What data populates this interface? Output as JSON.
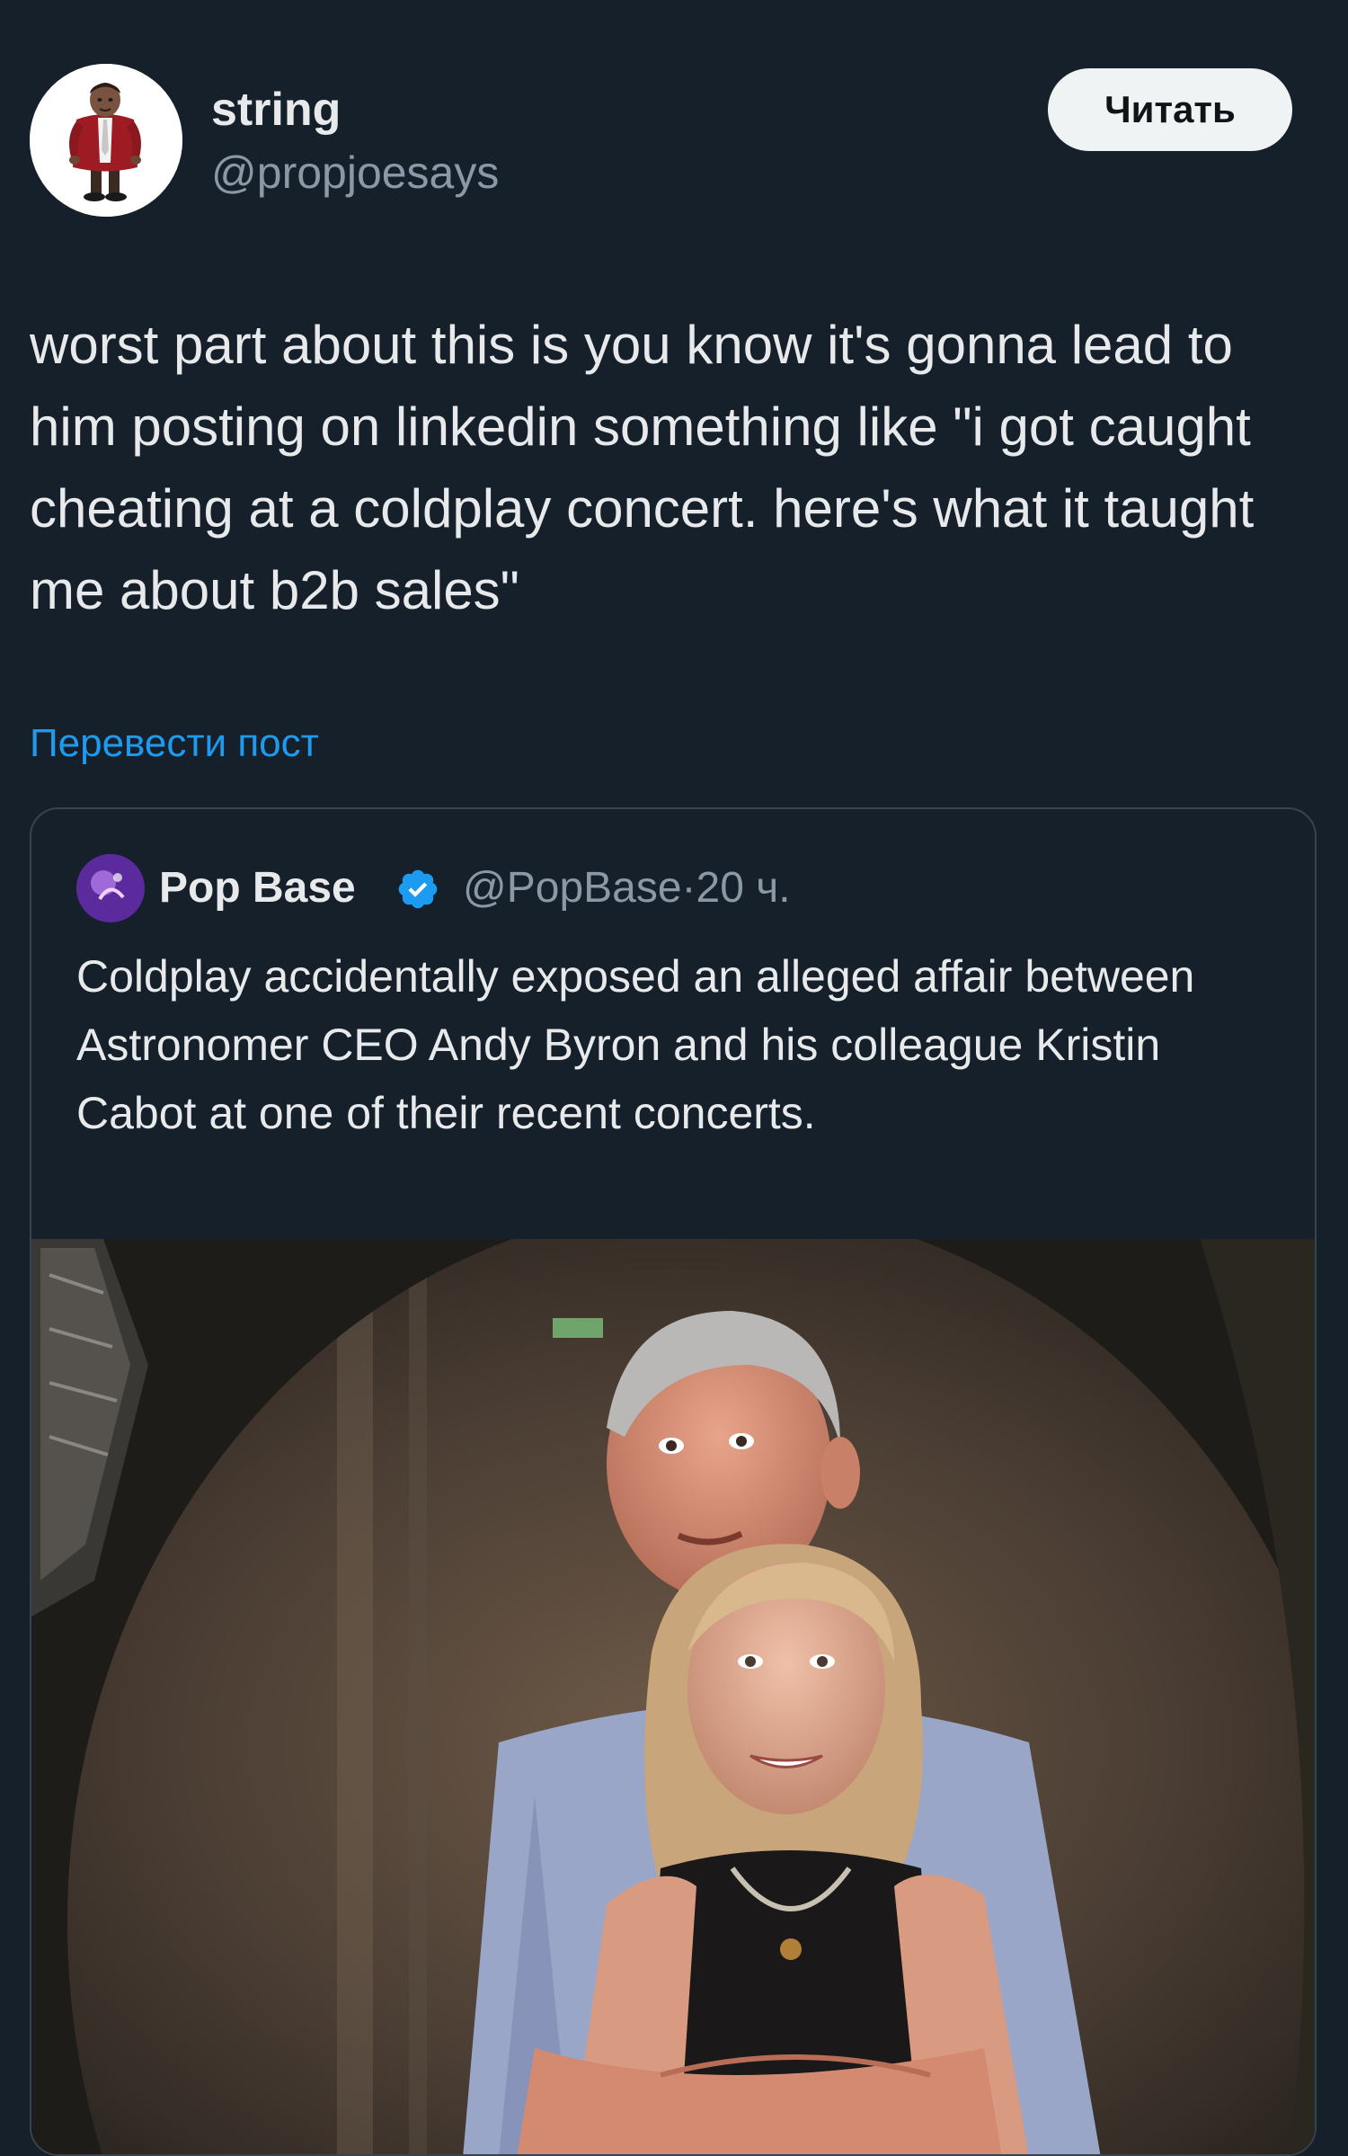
{
  "author": {
    "display_name": "string",
    "handle": "@propjoesays",
    "follow_label": "Читать"
  },
  "tweet": {
    "text": "worst part about this is you know it's gonna lead to him posting on linkedin something like \"i got caught cheating at a coldplay concert. here's what it taught me about b2b sales\"",
    "translate_label": "Перевести пост"
  },
  "quote": {
    "display_name": "Pop Base",
    "handle": "@PopBase",
    "separator": "·",
    "time": "20 ч.",
    "text": "Coldplay accidentally exposed an alleged affair between Astronomer CEO Andy Byron and his colleague Kristin Cabot at one of their recent concerts.",
    "verified": true
  },
  "colors": {
    "background": "#15202b",
    "accent": "#1d9bf0",
    "text_primary": "#e7e9ea",
    "text_secondary": "#8b98a5",
    "border": "#38444d",
    "button_bg": "#eff3f4"
  },
  "icons": {
    "verified": "verified-badge-icon"
  }
}
